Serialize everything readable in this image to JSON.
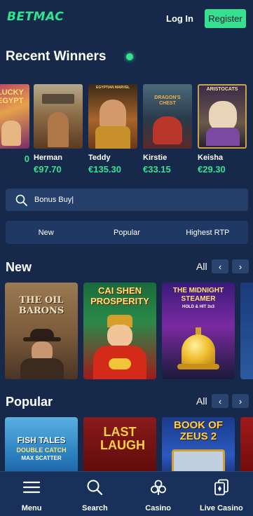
{
  "header": {
    "logo_text": "BETMAC",
    "login_label": "Log In",
    "register_label": "Register"
  },
  "recent_winners": {
    "title": "Recent Winners",
    "items": [
      {
        "name": "",
        "amount": "0",
        "game_title": "LUCKY EGYPT"
      },
      {
        "name": "Herman",
        "amount": "€97.70",
        "game_title": ""
      },
      {
        "name": "Teddy",
        "amount": "€135.30",
        "game_title": "EGYPTIAN MARVEL"
      },
      {
        "name": "Kirstie",
        "amount": "€33.15",
        "game_title": "DRAGON'S CHEST"
      },
      {
        "name": "Keisha",
        "amount": "€29.30",
        "game_title": "ARISTOCATS"
      }
    ]
  },
  "search": {
    "value": "Bonus Buy|"
  },
  "tabs": [
    {
      "label": "New"
    },
    {
      "label": "Popular"
    },
    {
      "label": "Highest RTP"
    }
  ],
  "sections": {
    "new": {
      "title": "New",
      "all_label": "All",
      "games": [
        {
          "title": "THE OIL BARONS"
        },
        {
          "title": "CAI SHEN PROSPERITY"
        },
        {
          "title": "THE MIDNIGHT STEAMER",
          "subtitle": "HOLD & HIT 3x3"
        }
      ]
    },
    "popular": {
      "title": "Popular",
      "all_label": "All",
      "games": [
        {
          "title": "FISH TALES",
          "subtitle": "DOUBLE CATCH",
          "tag": "MAX SCATTER"
        },
        {
          "title": "LAST LAUGH"
        },
        {
          "title": "BOOK OF ZEUS 2"
        }
      ]
    }
  },
  "bottom_nav": [
    {
      "label": "Menu",
      "icon": "menu-icon"
    },
    {
      "label": "Search",
      "icon": "search-icon"
    },
    {
      "label": "Casino",
      "icon": "casino-icon"
    },
    {
      "label": "Live Casino",
      "icon": "live-casino-icon"
    }
  ],
  "colors": {
    "background": "#16294b",
    "accent": "#36e28f",
    "panel": "#253f6b"
  }
}
